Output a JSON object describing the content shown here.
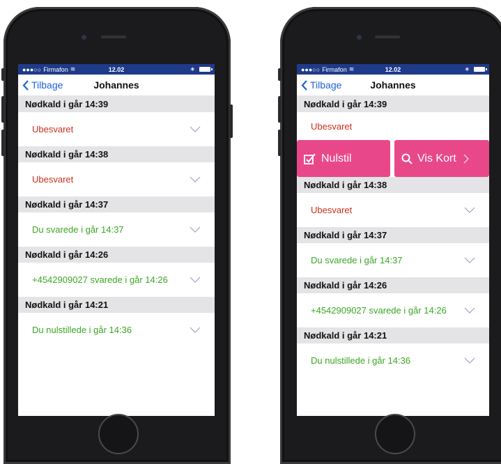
{
  "status_bar": {
    "carrier": "Firmafon",
    "time": "12.02"
  },
  "nav": {
    "back_label": "Tilbage",
    "title": "Johannes"
  },
  "calls": [
    {
      "header": "Nødkald i går 14:39",
      "status": "Ubesvaret",
      "color": "#c8301e"
    },
    {
      "header": "Nødkald i går 14:38",
      "status": "Ubesvaret",
      "color": "#c8301e"
    },
    {
      "header": "Nødkald i går 14:37",
      "status": "Du svarede i går 14:37",
      "color": "#3aa623"
    },
    {
      "header": "Nødkald i går 14:26",
      "status": "+4542909027 svarede i går 14:26",
      "color": "#3aa623"
    },
    {
      "header": "Nødkald i går 14:21",
      "status": "Du nulstillede i går 14:36",
      "color": "#3aa623"
    }
  ],
  "actions": {
    "reset_label": "Nulstil",
    "map_label": "Vis Kort"
  },
  "colors": {
    "accent": "#1c63d6",
    "status_bar": "#1e3a8a",
    "action_bg": "#e8488a",
    "header_bg": "#e4e4e7"
  }
}
